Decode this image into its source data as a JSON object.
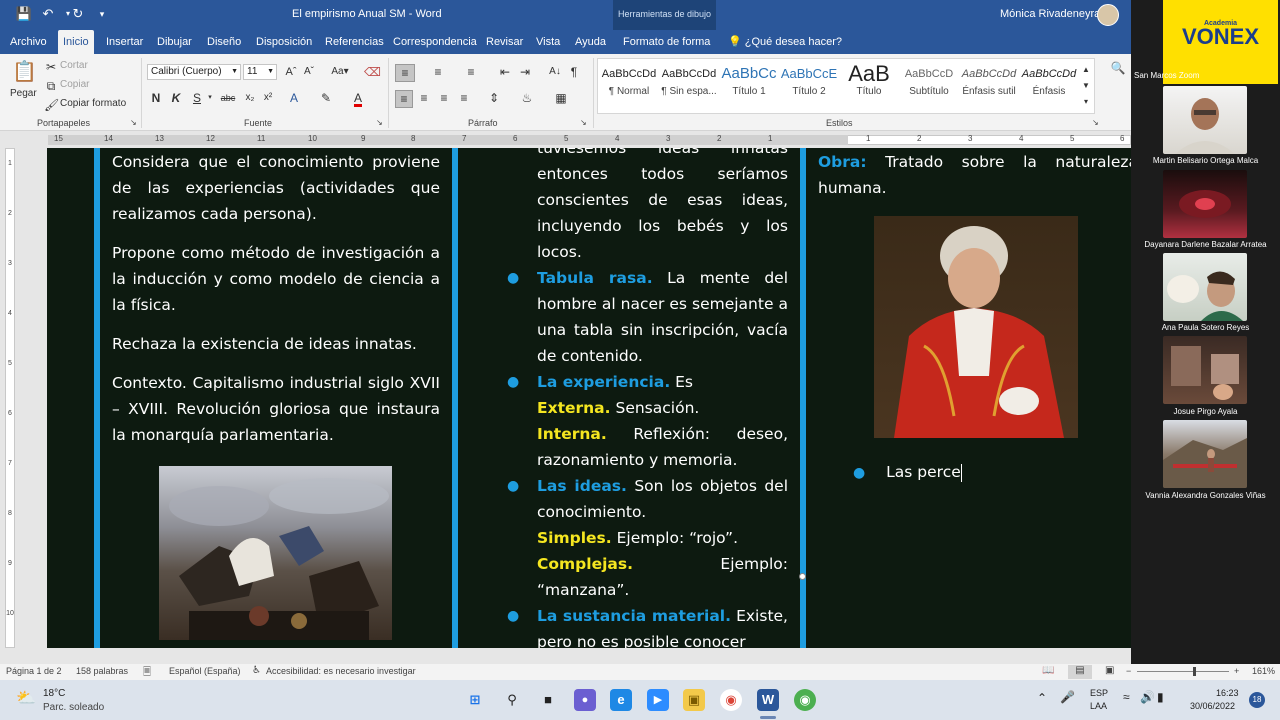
{
  "window": {
    "title": "El empirismo Anual SM  -  Word",
    "context_tab": "Herramientas de dibujo",
    "user_name": "Mónica Rivadeneyra"
  },
  "ribbon_tabs": [
    "Archivo",
    "Inicio",
    "Insertar",
    "Dibujar",
    "Diseño",
    "Disposición",
    "Referencias",
    "Correspondencia",
    "Revisar",
    "Vista",
    "Ayuda",
    "Formato de forma"
  ],
  "ribbon_search": "¿Qué desea hacer?",
  "clipboard": {
    "paste": "Pegar",
    "cut": "Cortar",
    "copy": "Copiar",
    "format_painter": "Copiar formato",
    "label": "Portapapeles"
  },
  "font": {
    "name": "Calibri (Cuerpo)",
    "size": "11",
    "label": "Fuente"
  },
  "paragraph": {
    "label": "Párrafo"
  },
  "styles": {
    "label": "Estilos",
    "items": [
      {
        "sample": "AaBbCcDd",
        "name": "¶ Normal"
      },
      {
        "sample": "AaBbCcDd",
        "name": "¶ Sin espa..."
      },
      {
        "sample": "AaBbCc",
        "name": "Título 1"
      },
      {
        "sample": "AaBbCcE",
        "name": "Título 2"
      },
      {
        "sample": "AaB",
        "name": "Título"
      },
      {
        "sample": "AaBbCcD",
        "name": "Subtítulo"
      },
      {
        "sample": "AaBbCcDd",
        "name": "Énfasis sutil"
      },
      {
        "sample": "AaBbCcDd",
        "name": "Énfasis"
      }
    ]
  },
  "ruler": {
    "numbers": [
      "15",
      "14",
      "13",
      "12",
      "11",
      "10",
      "9",
      "8",
      "7",
      "6",
      "5",
      "4",
      "3",
      "2",
      "1",
      "1",
      "2",
      "3",
      "4",
      "5",
      "6"
    ]
  },
  "vruler": {
    "numbers": [
      "1",
      "2",
      "3",
      "4",
      "5",
      "6",
      "7",
      "8",
      "9",
      "10"
    ]
  },
  "document": {
    "col1": {
      "p1": "Considera que el conocimiento proviene de las experiencias (actividades que realizamos cada persona).",
      "p2": "Propone como método de investigación a la inducción y como modelo de ciencia a la física.",
      "p3": "Rechaza la existencia de ideas innatas.",
      "p4": "Contexto. Capitalismo industrial siglo XVII – XVIII. Revolución gloriosa que instaura la monarquía parlamentaria."
    },
    "col2": {
      "intro": "tuviésemos ideas innatas entonces todos seríamos conscientes de esas ideas, incluyendo los bebés y los locos.",
      "tabula_head": "Tabula rasa.",
      "tabula_text": "La mente del hombre al nacer es semejante a una tabla sin inscripción, vacía de contenido.",
      "exp_head": "La experiencia.",
      "exp_text": "Es",
      "ext_head": "Externa.",
      "ext_text": "Sensación.",
      "int_head": "Interna.",
      "int_text": "Reflexión: deseo, razonamiento y memoria.",
      "ideas_head": "Las ideas.",
      "ideas_text": "Son los objetos del conocimiento.",
      "simple_head": "Simples.",
      "simple_text": "Ejemplo: “rojo”.",
      "complex_head": "Complejas.",
      "complex_text": "Ejemplo: “manzana”.",
      "subst_head": "La sustancia material.",
      "subst_text": "Existe, pero no es posible conocer"
    },
    "col3": {
      "obra_head": "Obra:",
      "obra_text": "Tratado sobre la naturaleza humana.",
      "bullet_text": "Las perce"
    }
  },
  "statusbar": {
    "page": "Página 1 de 2",
    "words": "158 palabras",
    "language": "Español (España)",
    "accessibility": "Accesibilidad: es necesario investigar",
    "zoom": "161%"
  },
  "taskbar": {
    "weather_temp": "18°C",
    "weather_text": "Parc. soleado",
    "lang_1": "ESP",
    "lang_2": "LAA",
    "time": "16:23",
    "date": "30/06/2022",
    "notif": "18"
  },
  "zoom_panel": {
    "logo_top": "Academia",
    "logo": "VONEX",
    "host_label": "San Marcos Zoom",
    "participants": [
      "Martin Belisario Ortega Malca",
      "Dayanara Darlene Bazalar Arratea",
      "Ana Paula Sotero Reyes",
      "Josue Pirgo Ayala",
      "Vannia Alexandra Gonzales Viñas"
    ]
  },
  "colors": {
    "word_blue": "#2b579a",
    "doc_bg": "#0d1a10",
    "accent_blue": "#1e9de0",
    "accent_yellow": "#f5e620",
    "vonex_yellow": "#ffe000"
  }
}
